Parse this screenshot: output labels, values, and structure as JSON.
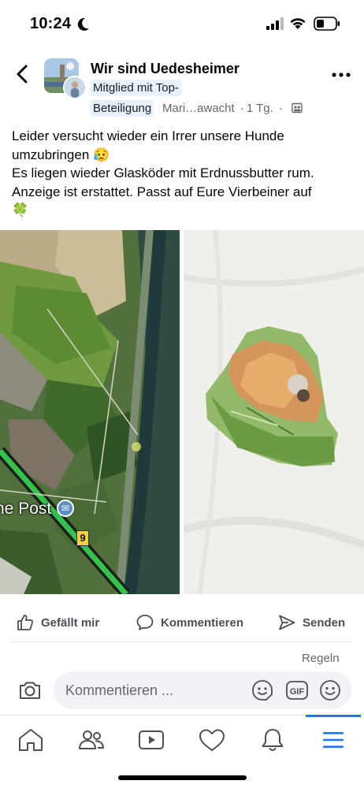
{
  "status_bar": {
    "time": "10:24"
  },
  "post": {
    "group_name": "Wir sind Uedesheimer",
    "badge_line1": "Mitglied mit Top-",
    "badge_line2": "Beteiligung",
    "author": "Mari…awacht",
    "separator": "·",
    "timestamp": "1 Tg.",
    "text_lines": [
      "Leider versucht wieder ein Irrer unsere Hunde",
      "umzubringen 😥",
      "Es liegen wieder Glasköder mit Erdnussbutter rum.",
      "Anzeige ist erstattet. Passt auf Eure Vierbeiner auf",
      "🍀"
    ],
    "map_label": "he Post",
    "route_number": "9"
  },
  "actions": {
    "like": "Gefällt mir",
    "comment": "Kommentieren",
    "send": "Senden"
  },
  "rules_link": "Regeln",
  "comment_input": {
    "placeholder": "Kommentieren ...",
    "gif_label": "GIF"
  },
  "tabbar": {
    "active_tab": "menu",
    "items": [
      "home",
      "friends",
      "video",
      "dating",
      "notifications",
      "menu"
    ]
  },
  "colors": {
    "accent": "#1877f2",
    "badge_bg": "#e7f0fd",
    "muted_text": "#65676b",
    "input_bg": "#f0f2f5"
  }
}
